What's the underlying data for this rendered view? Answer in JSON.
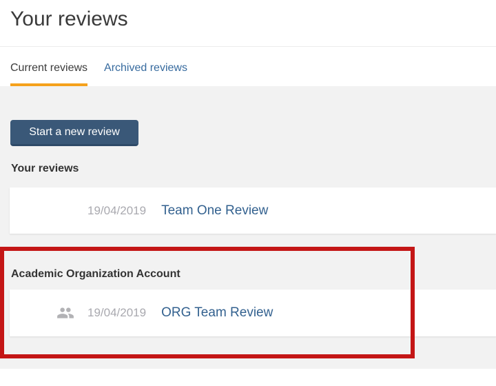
{
  "page": {
    "title": "Your reviews"
  },
  "tabs": {
    "current": {
      "label": "Current reviews",
      "active": true
    },
    "archived": {
      "label": "Archived reviews",
      "active": false
    }
  },
  "toolbar": {
    "start_review_label": "Start a new review"
  },
  "sections": [
    {
      "header": "Your reviews",
      "rows": [
        {
          "date": "19/04/2019",
          "title": "Team One Review"
        }
      ]
    },
    {
      "header": "Academic Organization Account",
      "highlighted": true,
      "rows": [
        {
          "date": "19/04/2019",
          "title": "ORG Team Review",
          "icon": "group-icon"
        }
      ]
    }
  ],
  "colors": {
    "accent_orange": "#f5a11c",
    "button_navy": "#3a5878",
    "button_navy_edge": "#2e4a68",
    "link_blue": "#33618f",
    "tab_link_blue": "#366a9e",
    "date_gray": "#a9a9af",
    "icon_gray": "#b2b2b5",
    "highlight_red": "#c41616",
    "content_bg": "#f2f2f2",
    "heading_gray": "#3a3a3a"
  }
}
